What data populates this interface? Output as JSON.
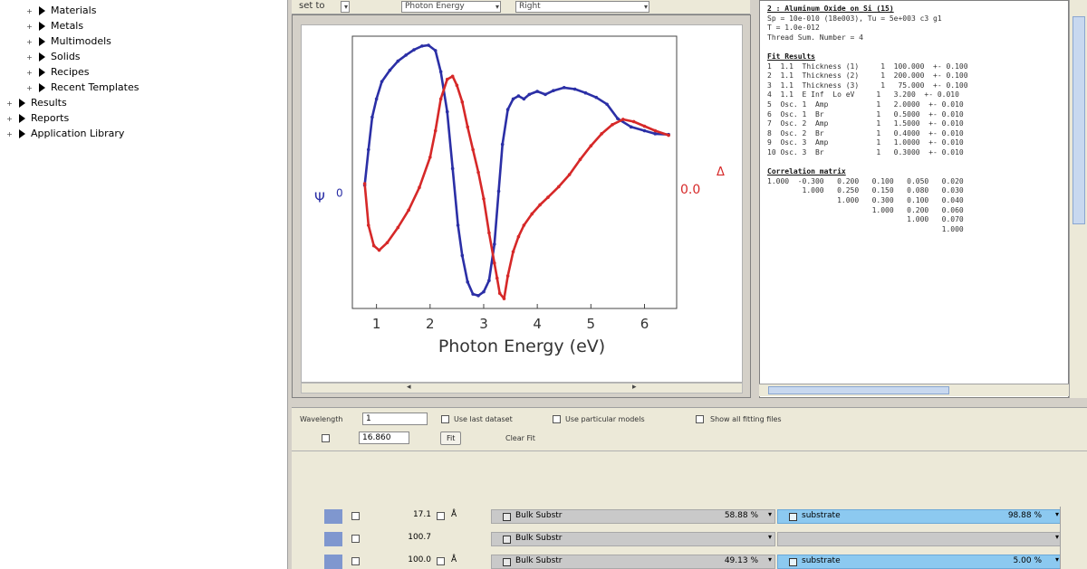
{
  "tree": {
    "items": [
      {
        "label": "Materials",
        "kind": "child"
      },
      {
        "label": "Metals",
        "kind": "child"
      },
      {
        "label": "Multimodels",
        "kind": "child"
      },
      {
        "label": "Solids",
        "kind": "child"
      },
      {
        "label": "Recipes",
        "kind": "child"
      },
      {
        "label": "Recent Templates",
        "kind": "child"
      },
      {
        "label": "Results",
        "kind": "root"
      },
      {
        "label": "Reports",
        "kind": "root"
      },
      {
        "label": "Application Library",
        "kind": "root"
      }
    ]
  },
  "toolbar": {
    "set_label": "set to",
    "opt1": "Photon Energy",
    "opt2": "Right"
  },
  "chart_data": {
    "type": "line",
    "xlabel": "Photon Energy (eV)",
    "x_ticks": [
      "1",
      "2",
      "3",
      "4",
      "5",
      "6"
    ],
    "xlim": [
      0.55,
      6.6
    ],
    "left_axis_label": "Ψ",
    "left_axis_tick": "0",
    "right_axis_label": "Δ",
    "right_axis_tick": "0.0",
    "series": [
      {
        "color": "#2b2fa6",
        "x": [
          0.78,
          0.85,
          0.92,
          1.0,
          1.1,
          1.25,
          1.4,
          1.55,
          1.7,
          1.85,
          1.97,
          2.1,
          2.2,
          2.32,
          2.42,
          2.52,
          2.6,
          2.7,
          2.8,
          2.9,
          3.0,
          3.1,
          3.2,
          3.28,
          3.35,
          3.45,
          3.55,
          3.65,
          3.75,
          3.85,
          4.0,
          4.15,
          4.3,
          4.5,
          4.7,
          4.9,
          5.1,
          5.3,
          5.5,
          5.75,
          6.0,
          6.2,
          6.45
        ],
        "y": [
          0.08,
          0.55,
          0.98,
          1.22,
          1.45,
          1.6,
          1.72,
          1.8,
          1.87,
          1.92,
          1.93,
          1.86,
          1.58,
          1.05,
          0.3,
          -0.45,
          -0.85,
          -1.2,
          -1.36,
          -1.38,
          -1.33,
          -1.18,
          -0.7,
          0.0,
          0.62,
          1.08,
          1.22,
          1.26,
          1.22,
          1.28,
          1.32,
          1.28,
          1.33,
          1.37,
          1.35,
          1.3,
          1.24,
          1.15,
          0.96,
          0.85,
          0.8,
          0.76,
          0.75
        ]
      },
      {
        "color": "#d62828",
        "x": [
          0.78,
          0.85,
          0.95,
          1.05,
          1.2,
          1.4,
          1.6,
          1.8,
          2.0,
          2.1,
          2.2,
          2.32,
          2.42,
          2.5,
          2.6,
          2.7,
          2.8,
          2.9,
          3.0,
          3.1,
          3.2,
          3.25,
          3.3,
          3.38,
          3.45,
          3.55,
          3.65,
          3.75,
          3.9,
          4.05,
          4.2,
          4.4,
          4.6,
          4.8,
          5.0,
          5.2,
          5.4,
          5.6,
          5.8,
          6.0,
          6.2,
          6.45
        ],
        "y": [
          0.1,
          -0.45,
          -0.72,
          -0.78,
          -0.68,
          -0.48,
          -0.25,
          0.05,
          0.45,
          0.8,
          1.22,
          1.48,
          1.52,
          1.4,
          1.18,
          0.85,
          0.55,
          0.25,
          -0.1,
          -0.55,
          -0.95,
          -1.15,
          -1.35,
          -1.42,
          -1.12,
          -0.8,
          -0.6,
          -0.45,
          -0.3,
          -0.18,
          -0.08,
          0.06,
          0.22,
          0.42,
          0.6,
          0.76,
          0.88,
          0.95,
          0.92,
          0.86,
          0.8,
          0.74
        ]
      }
    ]
  },
  "output": {
    "lines": [
      {
        "text": "2 : Aluminum_Oxide_on_Si (15)",
        "style": "head"
      },
      {
        "text": "Sp = 10e-010 (18e003), Tu = 5e+003 c3 g1",
        "style": "normal"
      },
      {
        "text": "T = 1.0e-012",
        "style": "normal"
      },
      {
        "text": "Thread Sum. Number = 4",
        "style": "normal"
      },
      {
        "text": "",
        "style": "normal"
      },
      {
        "text": "Fit Results",
        "style": "head"
      },
      {
        "text": "1  1.1  Thickness (1)     1  100.000  +- 0.100",
        "style": "normal"
      },
      {
        "text": "2  1.1  Thickness (2)     1  200.000  +- 0.100",
        "style": "normal"
      },
      {
        "text": "3  1.1  Thickness (3)     1   75.000  +- 0.100",
        "style": "normal"
      },
      {
        "text": "4  1.1  E Inf  Lo eV     1   3.200  +- 0.010",
        "style": "normal"
      },
      {
        "text": "5  Osc. 1  Amp           1   2.0000  +- 0.010",
        "style": "normal"
      },
      {
        "text": "6  Osc. 1  Br            1   0.5000  +- 0.010",
        "style": "normal"
      },
      {
        "text": "7  Osc. 2  Amp           1   1.5000  +- 0.010",
        "style": "normal"
      },
      {
        "text": "8  Osc. 2  Br            1   0.4000  +- 0.010",
        "style": "normal"
      },
      {
        "text": "9  Osc. 3  Amp           1   1.0000  +- 0.010",
        "style": "normal"
      },
      {
        "text": "10 Osc. 3  Br            1   0.3000  +- 0.010",
        "style": "normal"
      },
      {
        "text": "",
        "style": "normal"
      },
      {
        "text": "Correlation matrix",
        "style": "head"
      },
      {
        "text": "1.000  -0.300   0.200   0.100   0.050   0.020",
        "style": "normal"
      },
      {
        "text": "        1.000   0.250   0.150   0.080   0.030",
        "style": "normal"
      },
      {
        "text": "                1.000   0.300   0.100   0.040",
        "style": "normal"
      },
      {
        "text": "                        1.000   0.200   0.060",
        "style": "normal"
      },
      {
        "text": "                                1.000   0.070",
        "style": "normal"
      },
      {
        "text": "                                        1.000",
        "style": "normal"
      }
    ]
  },
  "options": {
    "range_label": "Wavelength",
    "range_value": "1",
    "opt_a": "Use last dataset",
    "opt_b": "Use particular models",
    "opt_c": "Show all fitting files",
    "mse_value": "16.860",
    "fit_button": "Fit",
    "clear_button": "Clear Fit"
  },
  "models": [
    {
      "value": "17.1",
      "unit": "Å",
      "name": "Bulk Substr",
      "pct": "58.88 %",
      "comp": "substrate",
      "comp_pct": "98.88 %"
    },
    {
      "value": "100.7",
      "unit": "",
      "name": "Bulk Substr",
      "pct": "",
      "comp": "",
      "comp_pct": ""
    },
    {
      "value": "100.0",
      "unit": "Å",
      "name": "Bulk Substr",
      "pct": "49.13 %",
      "comp": "substrate",
      "comp_pct": "5.00 %"
    }
  ]
}
